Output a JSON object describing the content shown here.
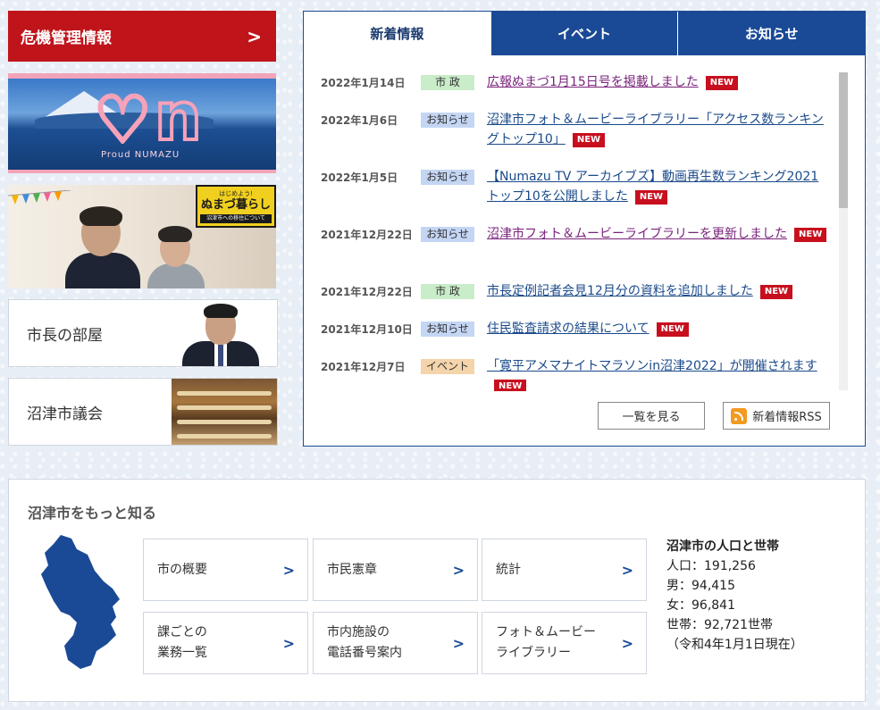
{
  "crisis": {
    "label": "危機管理情報",
    "arrow": ">"
  },
  "banner_proud": {
    "proud_text": "Proud NUMAZU"
  },
  "banner_life": {
    "sign_small": "はじめよう!",
    "sign_title": "ぬまづ暮らし",
    "sign_sub": "沼津市への移住について"
  },
  "mayor": {
    "label": "市長の部屋"
  },
  "council": {
    "label": "沼津市議会"
  },
  "news": {
    "tabs": [
      "新着情報",
      "イベント",
      "お知らせ"
    ],
    "new_badge": "NEW",
    "items": [
      {
        "date": "2022年1月14日",
        "category": "市 政",
        "title": "広報ぬまづ1月15日号を掲載しました"
      },
      {
        "date": "2022年1月6日",
        "category": "お知らせ",
        "title": "沼津市フォト＆ムービーライブラリー「アクセス数ランキングトップ10」"
      },
      {
        "date": "2022年1月5日",
        "category": "お知らせ",
        "title": "【Numazu TV アーカイブズ】動画再生数ランキング2021 トップ10を公開しました"
      },
      {
        "date": "2021年12月22日",
        "category": "お知らせ",
        "title": "沼津市フォト＆ムービーライブラリーを更新しました"
      },
      {
        "date": "2021年12月22日",
        "category": "市 政",
        "title": "市長定例記者会見12月分の資料を追加しました"
      },
      {
        "date": "2021年12月10日",
        "category": "お知らせ",
        "title": "住民監査請求の結果について"
      },
      {
        "date": "2021年12月7日",
        "category": "イベント",
        "title": "「寛平アメマナイトマラソンin沼津2022」が開催されます"
      }
    ],
    "list_button": "一覧を見る",
    "rss_button": "新着情報RSS"
  },
  "know": {
    "title": "沼津市をもっと知る",
    "tiles": [
      {
        "line1": "市の概要",
        "line2": ""
      },
      {
        "line1": "市民憲章",
        "line2": ""
      },
      {
        "line1": "統計",
        "line2": ""
      },
      {
        "line1": "課ごとの",
        "line2": "業務一覧"
      },
      {
        "line1": "市内施設の",
        "line2": "電話番号案内"
      },
      {
        "line1": "フォト＆ムービー",
        "line2": "ライブラリー"
      }
    ],
    "chevron": ">",
    "population": {
      "title": "沼津市の人口と世帯",
      "total": "人口：191,256",
      "male": "男：94,415",
      "female": "女：96,841",
      "households": "世帯：92,721世帯",
      "as_of": "（令和4年1月1日現在）"
    }
  },
  "colors": {
    "accent_red": "#c0141b",
    "tab_blue": "#1a4a96",
    "new_red": "#c80f1e"
  }
}
